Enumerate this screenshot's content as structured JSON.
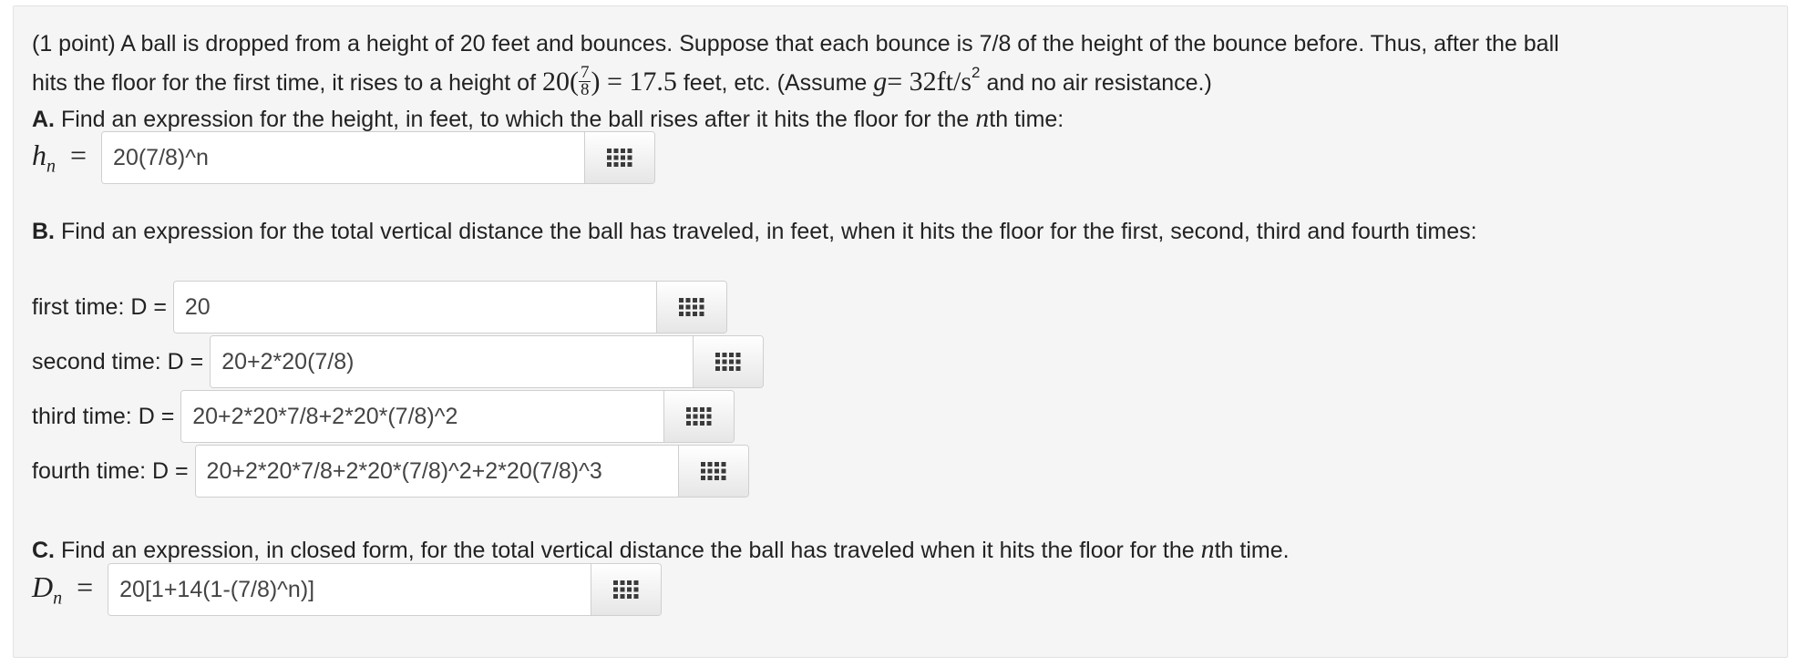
{
  "problem": {
    "intro_line1": "(1 point) A ball is dropped from a height of 20 feet and bounces. Suppose that each bounce is 7/8 of the height of the bounce before. Thus, after the ball",
    "intro_line2_a": "hits the floor for the first time, it rises to a height of",
    "math_20": "20",
    "frac_num": "7",
    "frac_den": "8",
    "math_result": ") = 17.5",
    "intro_line2_b": "feet, etc. (Assume",
    "g_var": "g",
    "g_value": "= 32ft/s",
    "g_exp": "2",
    "intro_line2_c": "and no air resistance.)"
  },
  "partA": {
    "letter": "A.",
    "prompt_a": "Find an expression for the height, in feet, to which the ball rises after it hits the floor for the",
    "n": "n",
    "prompt_b": "th time:",
    "lhs_var": "h",
    "lhs_sub": "n",
    "eq": "=",
    "value": "20(7/8)^n"
  },
  "partB": {
    "letter": "B.",
    "prompt": "Find an expression for the total vertical distance the ball has traveled, in feet, when it hits the floor for the first, second, third and fourth times:",
    "rows": [
      {
        "label": "first time: D = ",
        "value": "20"
      },
      {
        "label": "second time: D = ",
        "value": "20+2*20(7/8)"
      },
      {
        "label": "third time: D = ",
        "value": "20+2*20*7/8+2*20*(7/8)^2"
      },
      {
        "label": "fourth time: D = ",
        "value": "20+2*20*7/8+2*20*(7/8)^2+2*20(7/8)^3"
      }
    ]
  },
  "partC": {
    "letter": "C.",
    "prompt_a": "Find an expression, in closed form, for the total vertical distance the ball has traveled when it hits the floor for the",
    "n": "n",
    "prompt_b": "th time.",
    "lhs_var": "D",
    "lhs_sub": "n",
    "eq": "=",
    "value": "20[1+14(1-(7/8)^n)]"
  },
  "icons": {
    "equation_editor": "grid-icon"
  }
}
